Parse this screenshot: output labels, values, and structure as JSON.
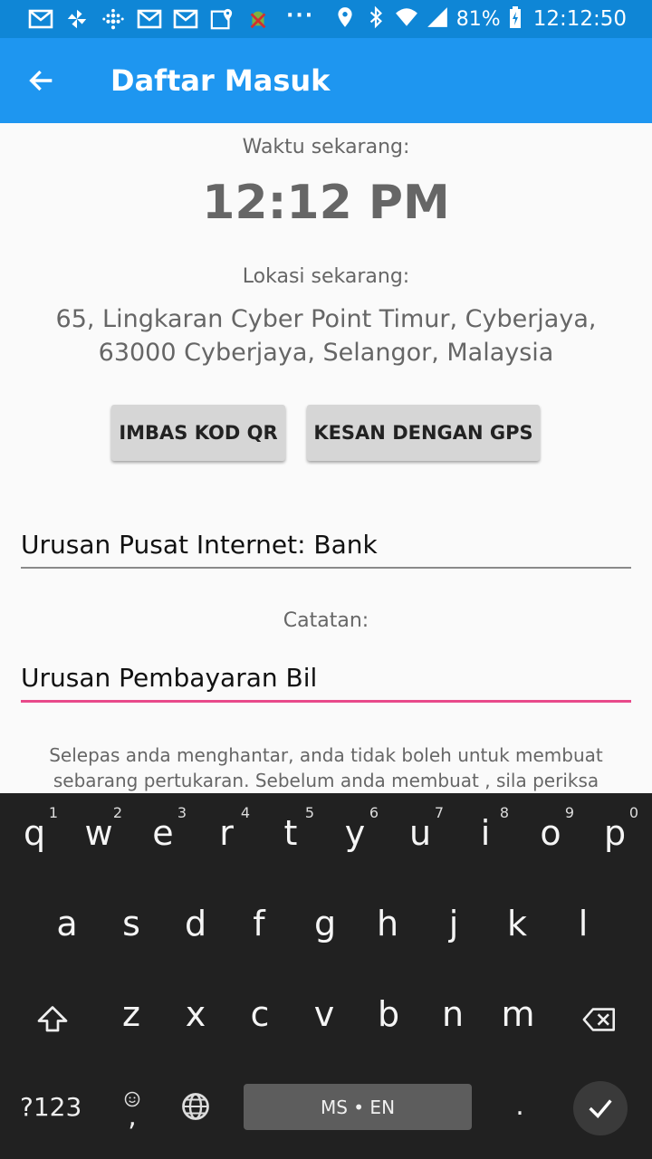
{
  "status_bar": {
    "left_icons": [
      "gmail-icon",
      "pinwheel-icon",
      "fitbit-icon",
      "gmail-icon",
      "gmail-icon",
      "maps-icon",
      "android-debug-icon"
    ],
    "more": "···",
    "battery": "81%",
    "time": "12:12:50"
  },
  "app_bar": {
    "title": "Daftar Masuk"
  },
  "main": {
    "time_label": "Waktu sekarang:",
    "time_value": "12:12 PM",
    "location_label": "Lokasi sekarang:",
    "address_line1": "65, Lingkaran Cyber Point Timur, Cyberjaya,",
    "address_line2": "63000 Cyberjaya, Selangor, Malaysia",
    "qr_button": "IMBAS KOD QR",
    "gps_button": "KESAN DENGAN GPS",
    "business_value": "Urusan Pusat Internet: Bank",
    "notes_label": "Catatan:",
    "notes_value": "Urusan Pembayaran Bil",
    "notice_line1": "Selepas anda menghantar, anda tidak boleh untuk membuat",
    "notice_line2": "sebarang pertukaran. Sebelum anda membuat , sila periksa"
  },
  "keyboard": {
    "row1": [
      {
        "key": "q",
        "num": "1"
      },
      {
        "key": "w",
        "num": "2"
      },
      {
        "key": "e",
        "num": "3"
      },
      {
        "key": "r",
        "num": "4"
      },
      {
        "key": "t",
        "num": "5"
      },
      {
        "key": "y",
        "num": "6"
      },
      {
        "key": "u",
        "num": "7"
      },
      {
        "key": "i",
        "num": "8"
      },
      {
        "key": "o",
        "num": "9"
      },
      {
        "key": "p",
        "num": "0"
      }
    ],
    "row2": [
      "a",
      "s",
      "d",
      "f",
      "g",
      "h",
      "j",
      "k",
      "l"
    ],
    "row3": [
      "z",
      "x",
      "c",
      "v",
      "b",
      "n",
      "m"
    ],
    "symbols_key": "?123",
    "comma_key": ",",
    "period_key": ".",
    "space_label": "MS • EN"
  },
  "colors": {
    "status_bar": "#0f86d6",
    "app_bar": "#1e96f0",
    "focused_underline": "#e84a8a",
    "keyboard_bg": "#212121"
  }
}
